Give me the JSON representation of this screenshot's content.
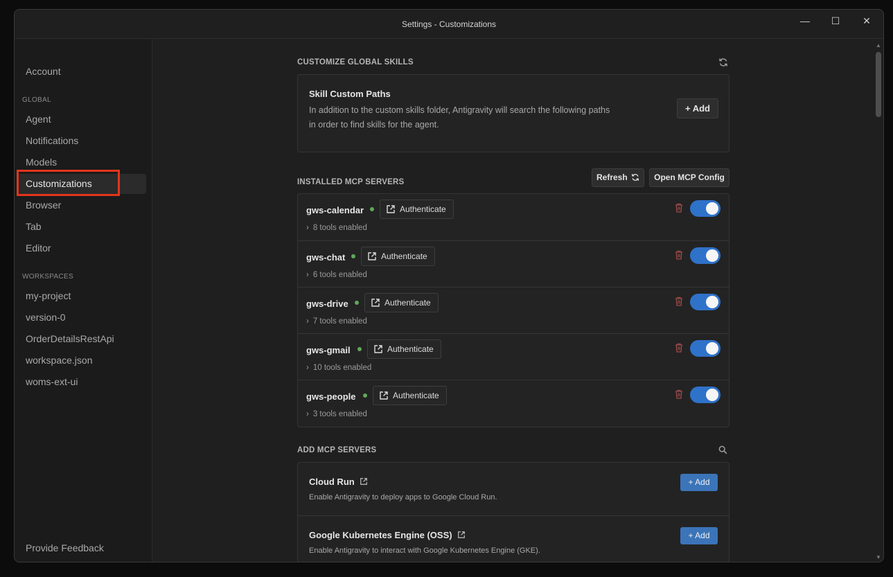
{
  "window": {
    "title": "Settings - Customizations",
    "controls": {
      "minimize": "—",
      "maximize": "☐",
      "close": "✕"
    }
  },
  "sidebar": {
    "account": "Account",
    "global_section": "GLOBAL",
    "global_items": [
      "Agent",
      "Notifications",
      "Models",
      "Customizations",
      "Browser",
      "Tab",
      "Editor"
    ],
    "active_item": "Customizations",
    "workspaces_section": "WORKSPACES",
    "workspace_items": [
      "my-project",
      "version-0",
      "OrderDetailsRestApi",
      "workspace.json",
      "woms-ext-ui"
    ],
    "feedback": "Provide Feedback"
  },
  "skills": {
    "header": "CUSTOMIZE GLOBAL SKILLS",
    "title": "Skill Custom Paths",
    "description_line1": "In addition to the custom skills folder, Antigravity will search the following paths",
    "description_line2": "in order to find skills for the agent.",
    "add_label": "+ Add"
  },
  "installed": {
    "header": "INSTALLED MCP SERVERS",
    "refresh_label": "Refresh",
    "config_label": "Open MCP Config",
    "auth_label": "Authenticate",
    "servers": [
      {
        "name": "gws-calendar",
        "tools": "8 tools enabled",
        "enabled": true
      },
      {
        "name": "gws-chat",
        "tools": "6 tools enabled",
        "enabled": true
      },
      {
        "name": "gws-drive",
        "tools": "7 tools enabled",
        "enabled": true
      },
      {
        "name": "gws-gmail",
        "tools": "10 tools enabled",
        "enabled": true
      },
      {
        "name": "gws-people",
        "tools": "3 tools enabled",
        "enabled": true
      }
    ]
  },
  "add_servers": {
    "header": "ADD MCP SERVERS",
    "add_label": "+ Add",
    "items": [
      {
        "title": "Cloud Run",
        "description": "Enable Antigravity to deploy apps to Google Cloud Run."
      },
      {
        "title": "Google Kubernetes Engine (OSS)",
        "description": "Enable Antigravity to interact with Google Kubernetes Engine (GKE)."
      }
    ]
  },
  "colors": {
    "accent": "#2f72c9",
    "add_button": "#3b74b8",
    "status_ok": "#5fa85a",
    "highlight": "#e3351b",
    "trash": "#a04a4a"
  }
}
